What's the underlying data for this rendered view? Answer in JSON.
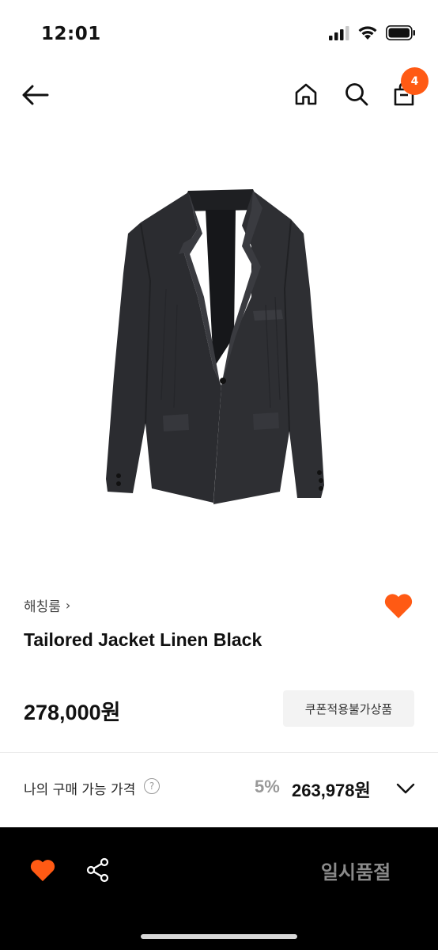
{
  "status_bar": {
    "time": "12:01"
  },
  "header": {
    "cart_count": "4"
  },
  "product": {
    "brand": "해칭룸",
    "brand_chevron": "›",
    "title": "Tailored Jacket Linen Black",
    "price": "278,000원",
    "coupon_note": "쿠폰적용불가상품"
  },
  "my_price": {
    "label": "나의 구매 가능 가격",
    "help_glyph": "?",
    "discount_rate": "5%",
    "discount_price": "263,978원"
  },
  "bottom_bar": {
    "sold_out_label": "일시품절"
  },
  "colors": {
    "accent": "#ff5a14",
    "bottom_bar_bg": "#000000",
    "muted_text": "#999999"
  }
}
